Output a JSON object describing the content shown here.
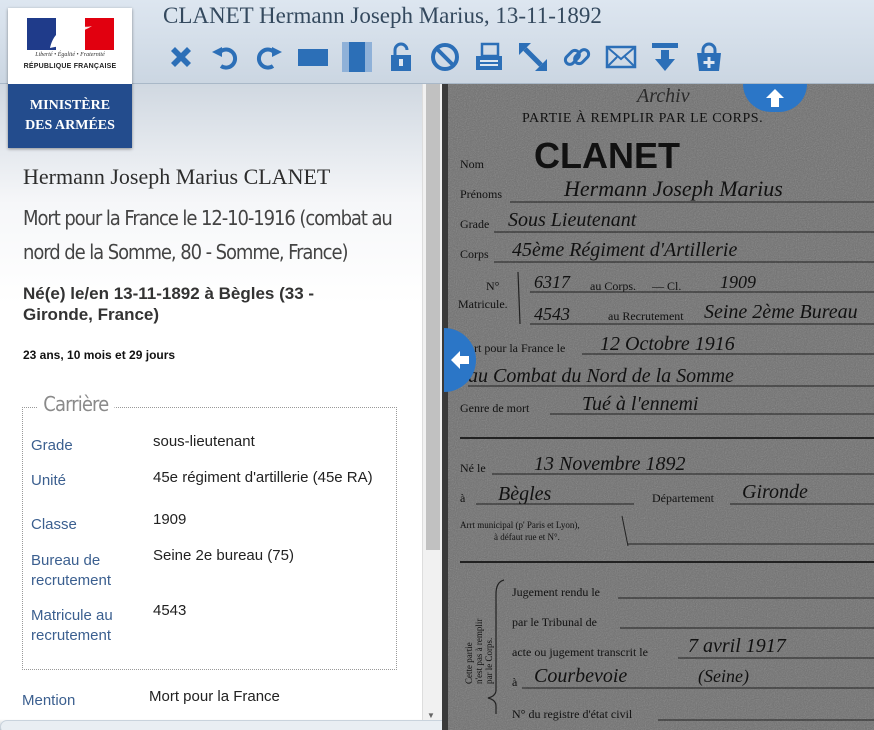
{
  "header": {
    "title": "CLANET Hermann Joseph Marius, 13-11-1892"
  },
  "toolbar": [
    {
      "icon": "close-icon"
    },
    {
      "icon": "rotate-left-icon"
    },
    {
      "icon": "rotate-right-icon"
    },
    {
      "icon": "fit-width-icon"
    },
    {
      "icon": "fit-height-icon"
    },
    {
      "icon": "unlock-icon"
    },
    {
      "icon": "no-entry-icon"
    },
    {
      "icon": "print-icon"
    },
    {
      "icon": "fullscreen-icon"
    },
    {
      "icon": "link-icon"
    },
    {
      "icon": "mail-icon"
    },
    {
      "icon": "download-icon"
    },
    {
      "icon": "add-basket-icon"
    }
  ],
  "logo": {
    "motto": "Liberté • Égalité • Fraternité",
    "republique": "RÉPUBLIQUE FRANÇAISE",
    "ministere_line1": "MINISTÈRE",
    "ministere_line2": "DES ARMÉES"
  },
  "person": {
    "name": "Hermann Joseph Marius CLANET",
    "death": "Mort pour la France le 12-10-1916 (combat au nord de la Somme, 80 - Somme, France)",
    "birth": "Né(e) le/en 13-11-1892 à Bègles (33 - Gironde, France)",
    "age": "23 ans, 10 mois et 29 jours"
  },
  "career": {
    "legend": "Carrière",
    "rows": [
      {
        "label": "Grade",
        "value": "sous-lieutenant"
      },
      {
        "label": "Unité",
        "value": "45e régiment d'artillerie (45e RA)"
      },
      {
        "label": "Classe",
        "value": "1909"
      },
      {
        "label": "Bureau de recrutement",
        "value": "Seine 2e bureau (75)"
      },
      {
        "label": "Matricule au recrutement",
        "value": "4543"
      }
    ]
  },
  "mention": {
    "label": "Mention",
    "value": "Mort pour la France"
  },
  "document": {
    "header": "PARTIE À REMPLIR PAR LE CORPS.",
    "top_scrawl": "Archiv",
    "nom_label": "Nom",
    "nom": "CLANET",
    "prenoms_label": "Prénoms",
    "prenoms": "Hermann Joseph Marius",
    "grade_label": "Grade",
    "grade": "Sous Lieutenant",
    "corps_label": "Corps",
    "corps": "45ème Régiment d'Artillerie",
    "no_label": "N°",
    "matricule_label": "Matricule.",
    "corps_no": "6317",
    "au_corps": "au Corps.",
    "cl": "— Cl.",
    "classe": "1909",
    "rec_no": "4543",
    "au_recrutement": "au Recrutement",
    "recrutement": "Seine 2ème Bureau",
    "mort_label": "ort pour la France le",
    "mort_date": "12 Octobre 1916",
    "combat": "au Combat du Nord de la Somme",
    "genre_label": "Genre de mort",
    "genre": "Tué à l'ennemi",
    "ne_label": "Né le",
    "ne_date": "13 Novembre 1892",
    "a_label": "à",
    "lieu": "Bègles",
    "departement_label": "Département",
    "departement": "Gironde",
    "arr_label1": "Arrt municipal (p' Paris et Lyon),",
    "arr_label2": "à défaut rue et N°.",
    "side_text1": "Cette partie",
    "side_text2": "n'est pas à remplir",
    "side_text3": "par le Corps.",
    "jugement": "Jugement rendu le",
    "tribunal": "par le Tribunal de",
    "acte_label": "acte ou jugement transcrit le",
    "acte_date": "7 avril 1917",
    "acte_lieu": "à",
    "commune": "Courbevoie",
    "commune_dept": "(Seine)",
    "registre": "N° du registre d'état civil"
  }
}
